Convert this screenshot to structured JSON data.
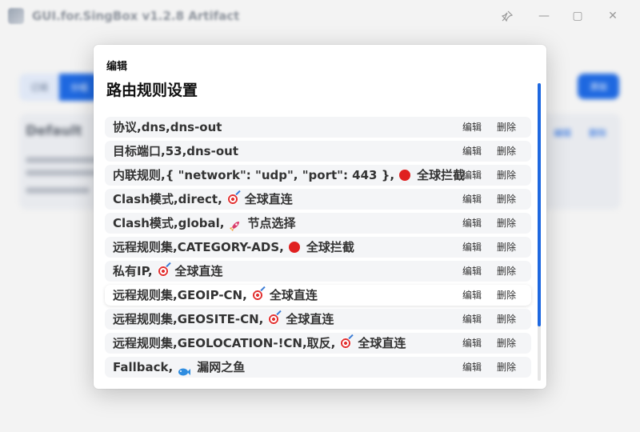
{
  "window": {
    "title": "GUI.for.SingBox v1.2.8 Artifact",
    "controls": {
      "pin_icon": "pin-icon",
      "minimize": "—",
      "maximize": "▢",
      "close": "✕"
    }
  },
  "background": {
    "tabs": [
      "订阅",
      "分组"
    ],
    "accent_button": "添加",
    "card_title": "Default",
    "card_links": [
      "编辑",
      "删除"
    ]
  },
  "modal": {
    "header": "编辑",
    "title": "路由规则设置",
    "edit_label": "编辑",
    "delete_label": "删除",
    "rules": [
      {
        "parts": [
          "协议,dns,dns-out"
        ],
        "emoji": null,
        "target": ""
      },
      {
        "parts": [
          "目标端口,53,dns-out"
        ],
        "emoji": null,
        "target": ""
      },
      {
        "parts": [
          "内联规则,{ \"network\": \"udp\", \"port\": 443 },"
        ],
        "emoji": "red-circle-icon",
        "target": "全球拦截"
      },
      {
        "parts": [
          "Clash模式,direct,"
        ],
        "emoji": "target-icon",
        "target": "全球直连"
      },
      {
        "parts": [
          "Clash模式,global,"
        ],
        "emoji": "rocket-icon",
        "target": "节点选择"
      },
      {
        "parts": [
          "远程规则集,CATEGORY-ADS,"
        ],
        "emoji": "red-circle-icon",
        "target": "全球拦截"
      },
      {
        "parts": [
          "私有IP,"
        ],
        "emoji": "target-icon",
        "target": "全球直连"
      },
      {
        "parts": [
          "远程规则集,GEOIP-CN,"
        ],
        "emoji": "target-icon",
        "target": "全球直连"
      },
      {
        "parts": [
          "远程规则集,GEOSITE-CN,"
        ],
        "emoji": "target-icon",
        "target": "全球直连"
      },
      {
        "parts": [
          "远程规则集,GEOLOCATION-!CN,取反,"
        ],
        "emoji": "target-icon",
        "target": "全球直连"
      },
      {
        "parts": [
          "Fallback,"
        ],
        "emoji": "fish-icon",
        "target": "漏网之鱼"
      }
    ]
  },
  "colors": {
    "accent": "#1e68e0",
    "row_bg": "#f4f5f7",
    "highlight_row_bg": "#ffffff"
  }
}
